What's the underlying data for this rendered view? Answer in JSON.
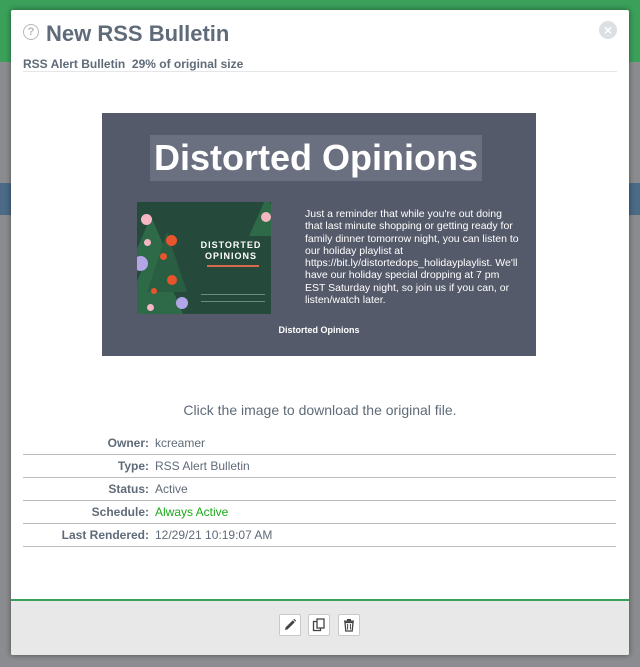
{
  "modal": {
    "title": "New RSS Bulletin",
    "subtitle": "RSS Alert Bulletin  29% of original size",
    "download_hint": "Click the image to download the original file."
  },
  "preview": {
    "heading": "Distorted Opinions",
    "promo_title": "DISTORTED OPINIONS",
    "body": "Just a reminder that while you're out doing that last minute shopping or getting ready for family dinner tomorrow night, you can listen to our holiday playlist at https://bit.ly/distortedops_holidayplaylist. We'll have our holiday special dropping at 7 pm EST Saturday night, so join us if you can, or listen/watch later.",
    "footer": "Distorted Opinions",
    "background_color": "#555a6a"
  },
  "details": {
    "owner_label": "Owner:",
    "owner_value": "kcreamer",
    "type_label": "Type:",
    "type_value": "RSS Alert Bulletin",
    "status_label": "Status:",
    "status_value": "Active",
    "schedule_label": "Schedule:",
    "schedule_value": "Always Active",
    "last_rendered_label": "Last Rendered:",
    "last_rendered_value": "12/29/21 10:19:07 AM"
  },
  "toolbar": {
    "edit_icon": "pencil-icon",
    "duplicate_icon": "copy-icon",
    "delete_icon": "trash-icon"
  },
  "colors": {
    "accent_green": "#3aa05a",
    "schedule_green": "#1aaa1a",
    "text_slate": "#5f6b78"
  }
}
